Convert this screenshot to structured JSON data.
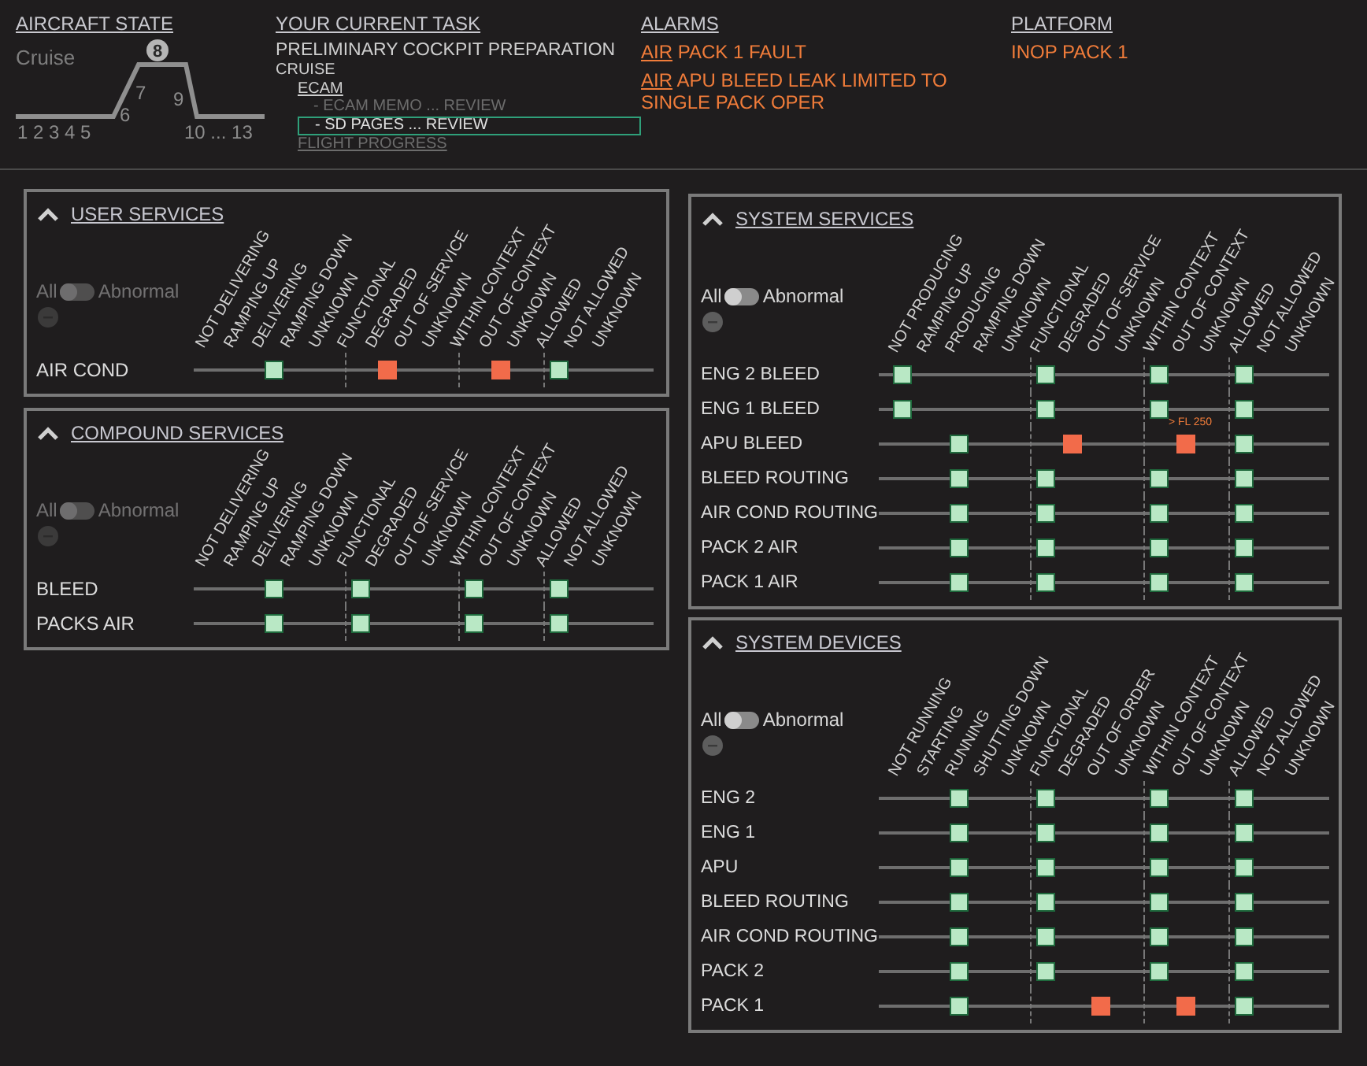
{
  "header": {
    "aircraft_state": {
      "title": "AIRCRAFT STATE",
      "phase_name": "Cruise",
      "phases": [
        {
          "label": "1 2 3 4 5",
          "selected": false
        },
        {
          "label": "6",
          "selected": false
        },
        {
          "label": "7",
          "selected": false
        },
        {
          "label": "8",
          "selected": true
        },
        {
          "label": "9",
          "selected": false
        },
        {
          "label": "10 ... 13",
          "selected": false
        }
      ]
    },
    "current_task": {
      "title": "YOUR CURRENT TASK",
      "items": [
        {
          "label": "PRELIMINARY COCKPIT PREPARATION",
          "kind": "heading",
          "dimmed": false,
          "selected": false
        },
        {
          "label": "CRUISE",
          "kind": "text",
          "dimmed": false,
          "selected": false,
          "children": [
            {
              "label": "ECAM",
              "kind": "link",
              "dimmed": false,
              "selected": false,
              "children": [
                {
                  "label": "- ECAM MEMO ... REVIEW",
                  "kind": "step",
                  "dimmed": true,
                  "selected": false
                },
                {
                  "label": "- SD PAGES ... REVIEW",
                  "kind": "step",
                  "dimmed": false,
                  "selected": true
                }
              ]
            },
            {
              "label": "FLIGHT PROGRESS",
              "kind": "link",
              "dimmed": true,
              "selected": false
            }
          ]
        }
      ]
    },
    "alarms": {
      "title": "ALARMS",
      "items": [
        {
          "system": "AIR",
          "message": "PACK 1 FAULT"
        },
        {
          "system": "AIR",
          "message": "APU BLEED LEAK LIMITED TO SINGLE PACK OPER"
        }
      ]
    },
    "platform": {
      "title": "PLATFORM",
      "items": [
        "INOP PACK 1"
      ]
    }
  },
  "left_column": [
    {
      "title": "USER SERVICES",
      "toggle": {
        "left": "All",
        "right": "Abnormal",
        "on": false,
        "disabled": true
      },
      "column_groups": [
        [
          "NOT DELIVERING",
          "RAMPING UP",
          "DELIVERING",
          "RAMPING DOWN",
          "UNKNOWN"
        ],
        [
          "FUNCTIONAL",
          "DEGRADED",
          "OUT OF SERVICE",
          "UNKNOWN"
        ],
        [
          "WITHIN CONTEXT",
          "OUT OF CONTEXT",
          "UNKNOWN"
        ],
        [
          "ALLOWED",
          "NOT ALLOWED",
          "UNKNOWN"
        ]
      ],
      "rows": [
        {
          "name": "AIR COND",
          "cells": [
            {
              "marked": false,
              "alert": false
            },
            {
              "marked": false,
              "alert": false
            },
            {
              "marked": true,
              "alert": false
            },
            {
              "marked": false,
              "alert": false
            },
            {
              "marked": false,
              "alert": false
            },
            {
              "marked": false,
              "alert": false
            },
            {
              "marked": true,
              "alert": true
            },
            {
              "marked": false,
              "alert": false
            },
            {
              "marked": false,
              "alert": false
            },
            {
              "marked": false,
              "alert": false
            },
            {
              "marked": true,
              "alert": true
            },
            {
              "marked": false,
              "alert": false
            },
            {
              "marked": true,
              "alert": false
            },
            {
              "marked": false,
              "alert": false
            },
            {
              "marked": false,
              "alert": false
            }
          ]
        }
      ]
    },
    {
      "title": "COMPOUND SERVICES",
      "toggle": {
        "left": "All",
        "right": "Abnormal",
        "on": false,
        "disabled": true
      },
      "column_groups": [
        [
          "NOT DELIVERING",
          "RAMPING UP",
          "DELIVERING",
          "RAMPING DOWN",
          "UNKNOWN"
        ],
        [
          "FUNCTIONAL",
          "DEGRADED",
          "OUT OF SERVICE",
          "UNKNOWN"
        ],
        [
          "WITHIN CONTEXT",
          "OUT OF CONTEXT",
          "UNKNOWN"
        ],
        [
          "ALLOWED",
          "NOT ALLOWED",
          "UNKNOWN"
        ]
      ],
      "rows": [
        {
          "name": "BLEED",
          "cells": [
            {
              "marked": false,
              "alert": false
            },
            {
              "marked": false,
              "alert": false
            },
            {
              "marked": true,
              "alert": false
            },
            {
              "marked": false,
              "alert": false
            },
            {
              "marked": false,
              "alert": false
            },
            {
              "marked": true,
              "alert": false
            },
            {
              "marked": false,
              "alert": false
            },
            {
              "marked": false,
              "alert": false
            },
            {
              "marked": false,
              "alert": false
            },
            {
              "marked": true,
              "alert": false
            },
            {
              "marked": false,
              "alert": false
            },
            {
              "marked": false,
              "alert": false
            },
            {
              "marked": true,
              "alert": false
            },
            {
              "marked": false,
              "alert": false
            },
            {
              "marked": false,
              "alert": false
            }
          ]
        },
        {
          "name": "PACKS AIR",
          "cells": [
            {
              "marked": false,
              "alert": false
            },
            {
              "marked": false,
              "alert": false
            },
            {
              "marked": true,
              "alert": false
            },
            {
              "marked": false,
              "alert": false
            },
            {
              "marked": false,
              "alert": false
            },
            {
              "marked": true,
              "alert": false
            },
            {
              "marked": false,
              "alert": false
            },
            {
              "marked": false,
              "alert": false
            },
            {
              "marked": false,
              "alert": false
            },
            {
              "marked": true,
              "alert": false
            },
            {
              "marked": false,
              "alert": false
            },
            {
              "marked": false,
              "alert": false
            },
            {
              "marked": true,
              "alert": false
            },
            {
              "marked": false,
              "alert": false
            },
            {
              "marked": false,
              "alert": false
            }
          ]
        }
      ]
    }
  ],
  "right_column": [
    {
      "title": "SYSTEM SERVICES",
      "toggle": {
        "left": "All",
        "right": "Abnormal",
        "on": false,
        "disabled": false
      },
      "column_groups": [
        [
          "NOT PRODUCING",
          "RAMPING UP",
          "PRODUCING",
          "RAMPING DOWN",
          "UNKNOWN"
        ],
        [
          "FUNCTIONAL",
          "DEGRADED",
          "OUT OF SERVICE",
          "UNKNOWN"
        ],
        [
          "WITHIN CONTEXT",
          "OUT OF CONTEXT",
          "UNKNOWN"
        ],
        [
          "ALLOWED",
          "NOT ALLOWED",
          "UNKNOWN"
        ]
      ],
      "rows": [
        {
          "name": "ENG 2 BLEED",
          "cells": [
            {
              "marked": true,
              "alert": false
            },
            {
              "marked": false,
              "alert": false
            },
            {
              "marked": false,
              "alert": false
            },
            {
              "marked": false,
              "alert": false
            },
            {
              "marked": false,
              "alert": false
            },
            {
              "marked": true,
              "alert": false
            },
            {
              "marked": false,
              "alert": false
            },
            {
              "marked": false,
              "alert": false
            },
            {
              "marked": false,
              "alert": false
            },
            {
              "marked": true,
              "alert": false
            },
            {
              "marked": false,
              "alert": false
            },
            {
              "marked": false,
              "alert": false
            },
            {
              "marked": true,
              "alert": false
            },
            {
              "marked": false,
              "alert": false
            },
            {
              "marked": false,
              "alert": false
            }
          ]
        },
        {
          "name": "ENG 1 BLEED",
          "cells": [
            {
              "marked": true,
              "alert": false
            },
            {
              "marked": false,
              "alert": false
            },
            {
              "marked": false,
              "alert": false
            },
            {
              "marked": false,
              "alert": false
            },
            {
              "marked": false,
              "alert": false
            },
            {
              "marked": true,
              "alert": false
            },
            {
              "marked": false,
              "alert": false
            },
            {
              "marked": false,
              "alert": false
            },
            {
              "marked": false,
              "alert": false
            },
            {
              "marked": true,
              "alert": false
            },
            {
              "marked": false,
              "alert": false
            },
            {
              "marked": false,
              "alert": false
            },
            {
              "marked": true,
              "alert": false
            },
            {
              "marked": false,
              "alert": false
            },
            {
              "marked": false,
              "alert": false
            }
          ]
        },
        {
          "name": "APU BLEED",
          "note": "> FL 250",
          "cells": [
            {
              "marked": false,
              "alert": false
            },
            {
              "marked": false,
              "alert": false
            },
            {
              "marked": true,
              "alert": false
            },
            {
              "marked": false,
              "alert": false
            },
            {
              "marked": false,
              "alert": false
            },
            {
              "marked": false,
              "alert": false
            },
            {
              "marked": true,
              "alert": true
            },
            {
              "marked": false,
              "alert": false
            },
            {
              "marked": false,
              "alert": false
            },
            {
              "marked": false,
              "alert": false
            },
            {
              "marked": true,
              "alert": true
            },
            {
              "marked": false,
              "alert": false
            },
            {
              "marked": true,
              "alert": false
            },
            {
              "marked": false,
              "alert": false
            },
            {
              "marked": false,
              "alert": false
            }
          ]
        },
        {
          "name": "BLEED ROUTING",
          "cells": [
            {
              "marked": false,
              "alert": false
            },
            {
              "marked": false,
              "alert": false
            },
            {
              "marked": true,
              "alert": false
            },
            {
              "marked": false,
              "alert": false
            },
            {
              "marked": false,
              "alert": false
            },
            {
              "marked": true,
              "alert": false
            },
            {
              "marked": false,
              "alert": false
            },
            {
              "marked": false,
              "alert": false
            },
            {
              "marked": false,
              "alert": false
            },
            {
              "marked": true,
              "alert": false
            },
            {
              "marked": false,
              "alert": false
            },
            {
              "marked": false,
              "alert": false
            },
            {
              "marked": true,
              "alert": false
            },
            {
              "marked": false,
              "alert": false
            },
            {
              "marked": false,
              "alert": false
            }
          ]
        },
        {
          "name": "AIR COND ROUTING",
          "cells": [
            {
              "marked": false,
              "alert": false
            },
            {
              "marked": false,
              "alert": false
            },
            {
              "marked": true,
              "alert": false
            },
            {
              "marked": false,
              "alert": false
            },
            {
              "marked": false,
              "alert": false
            },
            {
              "marked": true,
              "alert": false
            },
            {
              "marked": false,
              "alert": false
            },
            {
              "marked": false,
              "alert": false
            },
            {
              "marked": false,
              "alert": false
            },
            {
              "marked": true,
              "alert": false
            },
            {
              "marked": false,
              "alert": false
            },
            {
              "marked": false,
              "alert": false
            },
            {
              "marked": true,
              "alert": false
            },
            {
              "marked": false,
              "alert": false
            },
            {
              "marked": false,
              "alert": false
            }
          ]
        },
        {
          "name": "PACK 2 AIR",
          "cells": [
            {
              "marked": false,
              "alert": false
            },
            {
              "marked": false,
              "alert": false
            },
            {
              "marked": true,
              "alert": false
            },
            {
              "marked": false,
              "alert": false
            },
            {
              "marked": false,
              "alert": false
            },
            {
              "marked": true,
              "alert": false
            },
            {
              "marked": false,
              "alert": false
            },
            {
              "marked": false,
              "alert": false
            },
            {
              "marked": false,
              "alert": false
            },
            {
              "marked": true,
              "alert": false
            },
            {
              "marked": false,
              "alert": false
            },
            {
              "marked": false,
              "alert": false
            },
            {
              "marked": true,
              "alert": false
            },
            {
              "marked": false,
              "alert": false
            },
            {
              "marked": false,
              "alert": false
            }
          ]
        },
        {
          "name": "PACK 1 AIR",
          "cells": [
            {
              "marked": false,
              "alert": false
            },
            {
              "marked": false,
              "alert": false
            },
            {
              "marked": true,
              "alert": false
            },
            {
              "marked": false,
              "alert": false
            },
            {
              "marked": false,
              "alert": false
            },
            {
              "marked": true,
              "alert": false
            },
            {
              "marked": false,
              "alert": false
            },
            {
              "marked": false,
              "alert": false
            },
            {
              "marked": false,
              "alert": false
            },
            {
              "marked": true,
              "alert": false
            },
            {
              "marked": false,
              "alert": false
            },
            {
              "marked": false,
              "alert": false
            },
            {
              "marked": true,
              "alert": false
            },
            {
              "marked": false,
              "alert": false
            },
            {
              "marked": false,
              "alert": false
            }
          ]
        }
      ]
    },
    {
      "title": "SYSTEM DEVICES",
      "toggle": {
        "left": "All",
        "right": "Abnormal",
        "on": false,
        "disabled": false
      },
      "column_groups": [
        [
          "NOT RUNNING",
          "STARTING",
          "RUNNING",
          "SHUTTING DOWN",
          "UNKNOWN"
        ],
        [
          "FUNCTIONAL",
          "DEGRADED",
          "OUT OF ORDER",
          "UNKNOWN"
        ],
        [
          "WITHIN CONTEXT",
          "OUT OF CONTEXT",
          "UNKNOWN"
        ],
        [
          "ALLOWED",
          "NOT ALLOWED",
          "UNKNOWN"
        ]
      ],
      "rows": [
        {
          "name": "ENG 2",
          "cells": [
            {
              "marked": false,
              "alert": false
            },
            {
              "marked": false,
              "alert": false
            },
            {
              "marked": true,
              "alert": false
            },
            {
              "marked": false,
              "alert": false
            },
            {
              "marked": false,
              "alert": false
            },
            {
              "marked": true,
              "alert": false
            },
            {
              "marked": false,
              "alert": false
            },
            {
              "marked": false,
              "alert": false
            },
            {
              "marked": false,
              "alert": false
            },
            {
              "marked": true,
              "alert": false
            },
            {
              "marked": false,
              "alert": false
            },
            {
              "marked": false,
              "alert": false
            },
            {
              "marked": true,
              "alert": false
            },
            {
              "marked": false,
              "alert": false
            },
            {
              "marked": false,
              "alert": false
            }
          ]
        },
        {
          "name": "ENG 1",
          "cells": [
            {
              "marked": false,
              "alert": false
            },
            {
              "marked": false,
              "alert": false
            },
            {
              "marked": true,
              "alert": false
            },
            {
              "marked": false,
              "alert": false
            },
            {
              "marked": false,
              "alert": false
            },
            {
              "marked": true,
              "alert": false
            },
            {
              "marked": false,
              "alert": false
            },
            {
              "marked": false,
              "alert": false
            },
            {
              "marked": false,
              "alert": false
            },
            {
              "marked": true,
              "alert": false
            },
            {
              "marked": false,
              "alert": false
            },
            {
              "marked": false,
              "alert": false
            },
            {
              "marked": true,
              "alert": false
            },
            {
              "marked": false,
              "alert": false
            },
            {
              "marked": false,
              "alert": false
            }
          ]
        },
        {
          "name": "APU",
          "cells": [
            {
              "marked": false,
              "alert": false
            },
            {
              "marked": false,
              "alert": false
            },
            {
              "marked": true,
              "alert": false
            },
            {
              "marked": false,
              "alert": false
            },
            {
              "marked": false,
              "alert": false
            },
            {
              "marked": true,
              "alert": false
            },
            {
              "marked": false,
              "alert": false
            },
            {
              "marked": false,
              "alert": false
            },
            {
              "marked": false,
              "alert": false
            },
            {
              "marked": true,
              "alert": false
            },
            {
              "marked": false,
              "alert": false
            },
            {
              "marked": false,
              "alert": false
            },
            {
              "marked": true,
              "alert": false
            },
            {
              "marked": false,
              "alert": false
            },
            {
              "marked": false,
              "alert": false
            }
          ]
        },
        {
          "name": "BLEED ROUTING",
          "cells": [
            {
              "marked": false,
              "alert": false
            },
            {
              "marked": false,
              "alert": false
            },
            {
              "marked": true,
              "alert": false
            },
            {
              "marked": false,
              "alert": false
            },
            {
              "marked": false,
              "alert": false
            },
            {
              "marked": true,
              "alert": false
            },
            {
              "marked": false,
              "alert": false
            },
            {
              "marked": false,
              "alert": false
            },
            {
              "marked": false,
              "alert": false
            },
            {
              "marked": true,
              "alert": false
            },
            {
              "marked": false,
              "alert": false
            },
            {
              "marked": false,
              "alert": false
            },
            {
              "marked": true,
              "alert": false
            },
            {
              "marked": false,
              "alert": false
            },
            {
              "marked": false,
              "alert": false
            }
          ]
        },
        {
          "name": "AIR COND ROUTING",
          "cells": [
            {
              "marked": false,
              "alert": false
            },
            {
              "marked": false,
              "alert": false
            },
            {
              "marked": true,
              "alert": false
            },
            {
              "marked": false,
              "alert": false
            },
            {
              "marked": false,
              "alert": false
            },
            {
              "marked": true,
              "alert": false
            },
            {
              "marked": false,
              "alert": false
            },
            {
              "marked": false,
              "alert": false
            },
            {
              "marked": false,
              "alert": false
            },
            {
              "marked": true,
              "alert": false
            },
            {
              "marked": false,
              "alert": false
            },
            {
              "marked": false,
              "alert": false
            },
            {
              "marked": true,
              "alert": false
            },
            {
              "marked": false,
              "alert": false
            },
            {
              "marked": false,
              "alert": false
            }
          ]
        },
        {
          "name": "PACK 2",
          "cells": [
            {
              "marked": false,
              "alert": false
            },
            {
              "marked": false,
              "alert": false
            },
            {
              "marked": true,
              "alert": false
            },
            {
              "marked": false,
              "alert": false
            },
            {
              "marked": false,
              "alert": false
            },
            {
              "marked": true,
              "alert": false
            },
            {
              "marked": false,
              "alert": false
            },
            {
              "marked": false,
              "alert": false
            },
            {
              "marked": false,
              "alert": false
            },
            {
              "marked": true,
              "alert": false
            },
            {
              "marked": false,
              "alert": false
            },
            {
              "marked": false,
              "alert": false
            },
            {
              "marked": true,
              "alert": false
            },
            {
              "marked": false,
              "alert": false
            },
            {
              "marked": false,
              "alert": false
            }
          ]
        },
        {
          "name": "PACK 1",
          "cells": [
            {
              "marked": false,
              "alert": false
            },
            {
              "marked": false,
              "alert": false
            },
            {
              "marked": true,
              "alert": false
            },
            {
              "marked": false,
              "alert": false
            },
            {
              "marked": false,
              "alert": false
            },
            {
              "marked": false,
              "alert": false
            },
            {
              "marked": false,
              "alert": false
            },
            {
              "marked": true,
              "alert": true
            },
            {
              "marked": false,
              "alert": false
            },
            {
              "marked": false,
              "alert": false
            },
            {
              "marked": true,
              "alert": true
            },
            {
              "marked": false,
              "alert": false
            },
            {
              "marked": true,
              "alert": false
            },
            {
              "marked": false,
              "alert": false
            },
            {
              "marked": false,
              "alert": false
            }
          ]
        }
      ]
    }
  ]
}
